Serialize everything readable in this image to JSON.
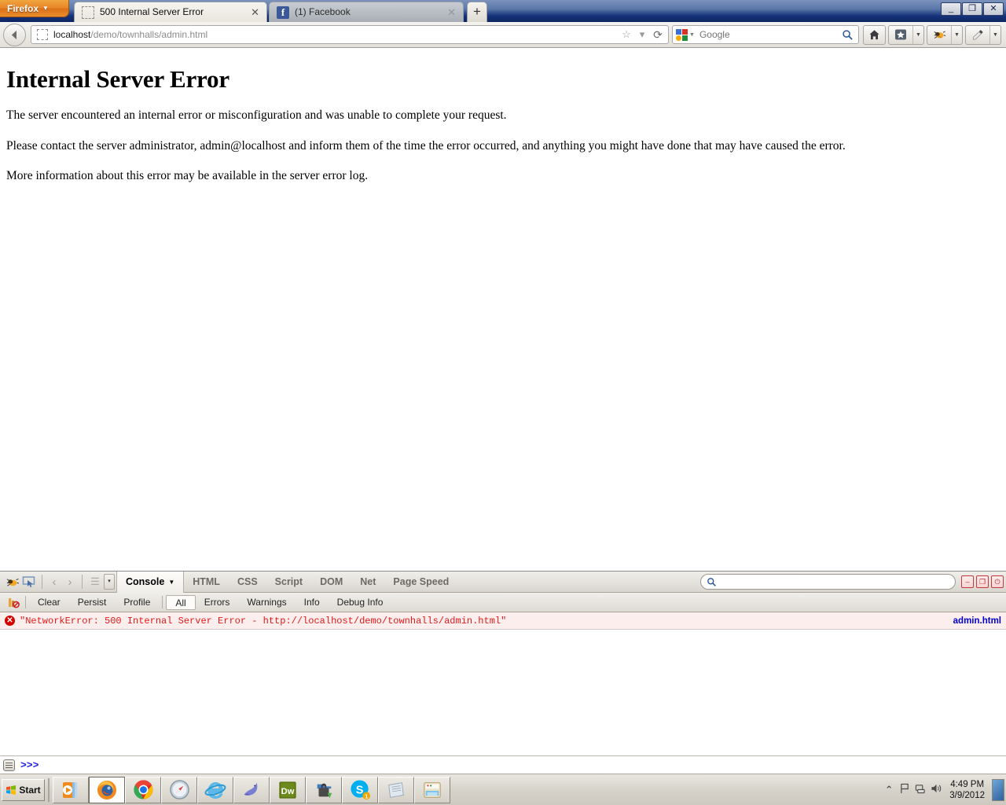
{
  "window": {
    "firefox_button": "Firefox",
    "controls": {
      "minimize": "_",
      "restore": "❐",
      "close": "✕"
    }
  },
  "tabs": [
    {
      "title": "500 Internal Server Error",
      "favicon": "blank-favicon",
      "active": true,
      "close": "✕"
    },
    {
      "title": "(1) Facebook",
      "favicon": "facebook-favicon",
      "active": false,
      "close": "✕"
    }
  ],
  "newtab_label": "+",
  "navbar": {
    "back_icon": "back-arrow-icon",
    "url_host": "localhost",
    "url_path": "/demo/townhalls/admin.html",
    "bookmark_star_icon": "star-icon",
    "dropdown_icon": "chevron-down-icon",
    "reload_icon": "reload-icon",
    "search_engine": "Google",
    "search_value": "",
    "search_placeholder": "Google",
    "search_icon": "magnifier-icon",
    "home_icon": "home-icon",
    "bookmarks_icon": "bookmarks-star-icon",
    "firebug_icon": "firebug-bug-icon",
    "colorpicker_icon": "eyedropper-icon"
  },
  "page": {
    "heading": "Internal Server Error",
    "paragraphs": [
      "The server encountered an internal error or misconfiguration and was unable to complete your request.",
      "Please contact the server administrator, admin@localhost and inform them of the time the error occurred, and anything you might have done that may have caused the error.",
      "More information about this error may be available in the server error log."
    ]
  },
  "firebug": {
    "icons": {
      "bug": "firebug-bug-icon",
      "inspector": "inspector-cursor-icon",
      "back": "‹",
      "forward": "›",
      "menu": "☰",
      "caret": "▾"
    },
    "tabs": [
      {
        "label": "Console",
        "active": true,
        "has_caret": true
      },
      {
        "label": "HTML",
        "active": false,
        "has_caret": false
      },
      {
        "label": "CSS",
        "active": false,
        "has_caret": false
      },
      {
        "label": "Script",
        "active": false,
        "has_caret": false
      },
      {
        "label": "DOM",
        "active": false,
        "has_caret": false
      },
      {
        "label": "Net",
        "active": false,
        "has_caret": false
      },
      {
        "label": "Page Speed",
        "active": false,
        "has_caret": false
      }
    ],
    "search": {
      "value": "",
      "placeholder": "",
      "icon": "magnifier-icon"
    },
    "window_buttons": [
      {
        "name": "minimize-panel-button",
        "glyph": "–"
      },
      {
        "name": "detach-panel-button",
        "glyph": "❐"
      },
      {
        "name": "close-panel-button",
        "glyph": "⏻"
      }
    ],
    "subtoolbar": {
      "filter_icon": "clear-filter-icon",
      "items": [
        {
          "label": "Clear",
          "active": false
        },
        {
          "label": "Persist",
          "active": false
        },
        {
          "label": "Profile",
          "active": false
        },
        {
          "label": "All",
          "active": true
        },
        {
          "label": "Errors",
          "active": false
        },
        {
          "label": "Warnings",
          "active": false
        },
        {
          "label": "Info",
          "active": false
        },
        {
          "label": "Debug Info",
          "active": false
        }
      ]
    },
    "log_entries": [
      {
        "severity": "error",
        "icon_glyph": "✕",
        "message": "\"NetworkError: 500 Internal Server Error - http://localhost/demo/townhalls/admin.html\"",
        "source": "admin.html"
      }
    ],
    "commandline": {
      "icon": "commandline-menu-icon",
      "prompt": ">>>",
      "value": "",
      "placeholder": ""
    }
  },
  "taskbar": {
    "start_label": "Start",
    "start_icon": "windows-flag-icon",
    "apps": [
      {
        "name": "media-player",
        "icon": "media-player-icon",
        "active": false
      },
      {
        "name": "firefox",
        "icon": "firefox-icon",
        "active": true
      },
      {
        "name": "chrome",
        "icon": "chrome-icon",
        "active": false
      },
      {
        "name": "safari",
        "icon": "safari-compass-icon",
        "active": false
      },
      {
        "name": "internet-explorer",
        "icon": "internet-explorer-icon",
        "active": false
      },
      {
        "name": "mysql-workbench",
        "icon": "dolphin-icon",
        "active": false
      },
      {
        "name": "dreamweaver",
        "icon": "dreamweaver-icon",
        "active": false
      },
      {
        "name": "secure-folder",
        "icon": "lock-icon",
        "active": false
      },
      {
        "name": "skype",
        "icon": "skype-icon",
        "active": false
      },
      {
        "name": "notepad",
        "icon": "notepad-icon",
        "active": false
      },
      {
        "name": "file-explorer",
        "icon": "folder-icon",
        "active": false
      }
    ],
    "tray": {
      "icons": [
        {
          "name": "show-hidden-icons",
          "glyph": "⌃"
        },
        {
          "name": "action-center-flag-icon",
          "glyph": "⚑"
        },
        {
          "name": "network-icon",
          "glyph": "🖧"
        },
        {
          "name": "volume-icon",
          "glyph": "🔊"
        }
      ],
      "time": "4:49 PM",
      "date": "3/9/2012"
    }
  }
}
